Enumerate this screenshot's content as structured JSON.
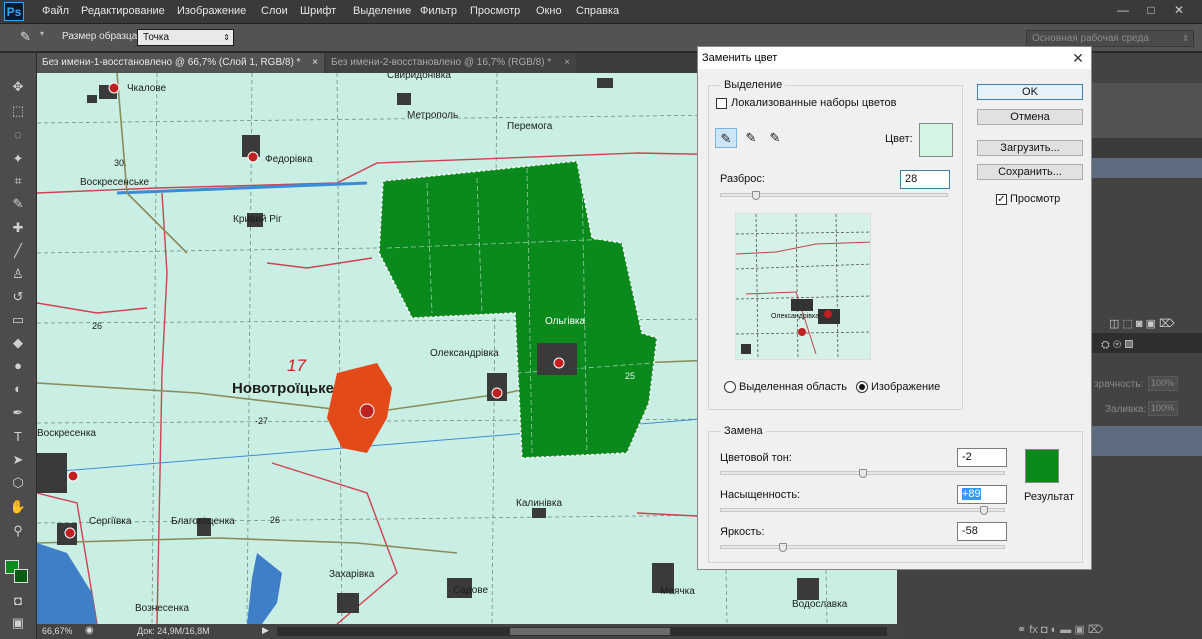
{
  "app": {
    "logo": "Ps"
  },
  "menu": [
    "Файл",
    "Редактирование",
    "Изображение",
    "Слои",
    "Шрифт",
    "Выделение",
    "Фильтр",
    "Просмотр",
    "Окно",
    "Справка"
  ],
  "window_controls": {
    "minimize": "—",
    "maximize": "□",
    "close": "✕"
  },
  "options": {
    "sample_size_label": "Размер образца:",
    "sample_size_value": "Точка",
    "workspace": "Основная рабочая среда"
  },
  "tabs": [
    {
      "label": "Без имени-1-восстановлено @ 66,7% (Слой 1, RGB/8) *",
      "close": "×"
    },
    {
      "label": "Без имени-2-восстановлено @ 16,7% (RGB/8) *",
      "close": "×"
    }
  ],
  "status": {
    "zoom": "66,67%",
    "doc": "Док: 24,9M/16,8M"
  },
  "map_labels": {
    "chkalove": "Чкалове",
    "svyrydonivka": "Свиридонівка",
    "metropol": "Метрополь",
    "peremoha": "Перемога",
    "fedorivka": "Федорівка",
    "voskresenske": "Воскресенське",
    "kryvyi_rih": "Кривий Ріг",
    "novotroitske": "Новотроїцьке",
    "number_17": "17",
    "oleksandrivka": "Олександрівка",
    "olhivka": "Ольгівка",
    "voskresenka": "Воскресенка",
    "serhiivka": "Сергіївка",
    "blahovishchenka": "Благовіщенка",
    "kalynivka": "Калинівка",
    "zakharivka": "Захарівка",
    "vozneenska": "Вознесенка",
    "sadove": "Садове",
    "maiachka": "Маячка",
    "vodoslavka": "Водославка",
    "n30": "30.",
    "n26": "26",
    "n27": "·27",
    "n26b": "26",
    "n25": "25"
  },
  "dialog": {
    "title": "Заменить цвет",
    "close": "✕",
    "selection": {
      "legend": "Выделение",
      "localized_label": "Локализованные наборы цветов",
      "localized_checked": false,
      "color_label": "Цвет:",
      "sample_color": "#d4f4e4",
      "fuzziness_label": "Разброс:",
      "fuzziness_value": "28",
      "fuzziness_level": 0.14,
      "radio_selection": "Выделенная область",
      "radio_image": "Изображение",
      "selected_radio": "image"
    },
    "buttons": {
      "ok": "OK",
      "cancel": "Отмена",
      "load": "Загрузить...",
      "save": "Сохранить..."
    },
    "preview_label": "Просмотр",
    "preview_checked": true,
    "replacement": {
      "legend": "Замена",
      "hue_label": "Цветовой тон:",
      "hue_value": "-2",
      "hue_level": 0.5,
      "saturation_label": "Насыщенность:",
      "saturation_value": "+89",
      "saturation_level": 0.94,
      "lightness_label": "Яркость:",
      "lightness_value": "-58",
      "lightness_level": 0.21,
      "result_label": "Результат",
      "result_color": "#0a8a1c"
    }
  },
  "panels": {
    "opacity_label": "зрачность:",
    "opacity_value": "100%",
    "fill_label": "Заливка:",
    "fill_value": "100%"
  },
  "colors": {
    "accent_green": "#0a8a1c",
    "map_bg": "#c9efe4",
    "settlement_orange": "#e24a1a"
  }
}
